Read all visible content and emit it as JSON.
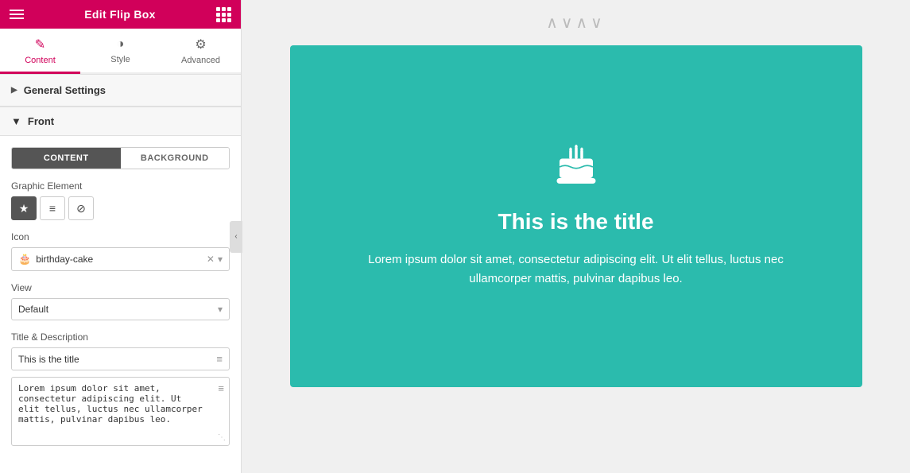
{
  "header": {
    "title": "Edit Flip Box"
  },
  "tabs": [
    {
      "id": "content",
      "label": "Content",
      "icon": "✎",
      "active": true
    },
    {
      "id": "style",
      "label": "Style",
      "icon": "◑",
      "active": false
    },
    {
      "id": "advanced",
      "label": "Advanced",
      "icon": "⚙",
      "active": false
    }
  ],
  "sections": {
    "general_settings": {
      "label": "General Settings",
      "expanded": false
    },
    "front": {
      "label": "Front",
      "expanded": true
    }
  },
  "content_tab": {
    "toggle_content": "CONTENT",
    "toggle_background": "BACKGROUND",
    "graphic_element_label": "Graphic Element",
    "icon_label": "Icon",
    "icon_value": "birthday-cake",
    "view_label": "View",
    "view_value": "Default",
    "title_description_label": "Title & Description",
    "title_value": "This is the title",
    "description_value": "Lorem ipsum dolor sit amet, consectetur adipiscing elit. Ut elit tellus, luctus nec ullamcorper mattis, pulvinar dapibus leo."
  },
  "preview": {
    "title": "This is the title",
    "description": "Lorem ipsum dolor sit amet, consectetur adipiscing elit. Ut elit tellus, luctus nec ullamcorper mattis, pulvinar dapibus leo.",
    "bg_color": "#2bbbad",
    "decoration": "∧∨∧∨"
  }
}
